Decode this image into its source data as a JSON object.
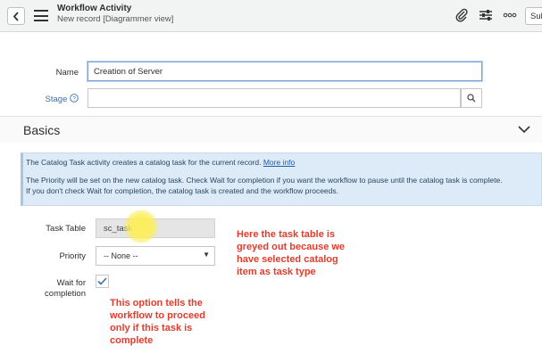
{
  "header": {
    "title": "Workflow Activity",
    "subtitle": "New record [Diagrammer view]",
    "submit_label_partial": "Sul"
  },
  "form": {
    "name_label": "Name",
    "name_value": "Creation of Server",
    "stage_label": "Stage",
    "stage_value": ""
  },
  "section": {
    "title": "Basics"
  },
  "info": {
    "line1": "The Catalog Task activity creates a catalog task for the current record.",
    "more_link": "More info",
    "line2": "The Priority will be set on the new catalog task. Check Wait for completion if you want the workflow to pause until the catalog task is complete.",
    "line3": "If you don't check Wait for completion, the catalog task is created and the workflow proceeds."
  },
  "fields": {
    "task_table_label": "Task Table",
    "task_table_value": "sc_task",
    "priority_label": "Priority",
    "priority_value": "-- None --",
    "wait_label_line1": "Wait for",
    "wait_label_line2": "completion",
    "wait_checked": true
  },
  "annotations": {
    "task_table_note": [
      "Here the task table is",
      "greyed out because we",
      "have selected catalog",
      "item as task type"
    ],
    "wait_note": [
      "This option tells the",
      "workflow to proceed",
      "only if this task is",
      "complete"
    ]
  },
  "colors": {
    "annotation": "#e53b2c",
    "info_bg": "#dcebf7",
    "link": "#1d5aa8",
    "checkmark": "#3a6ea8"
  }
}
